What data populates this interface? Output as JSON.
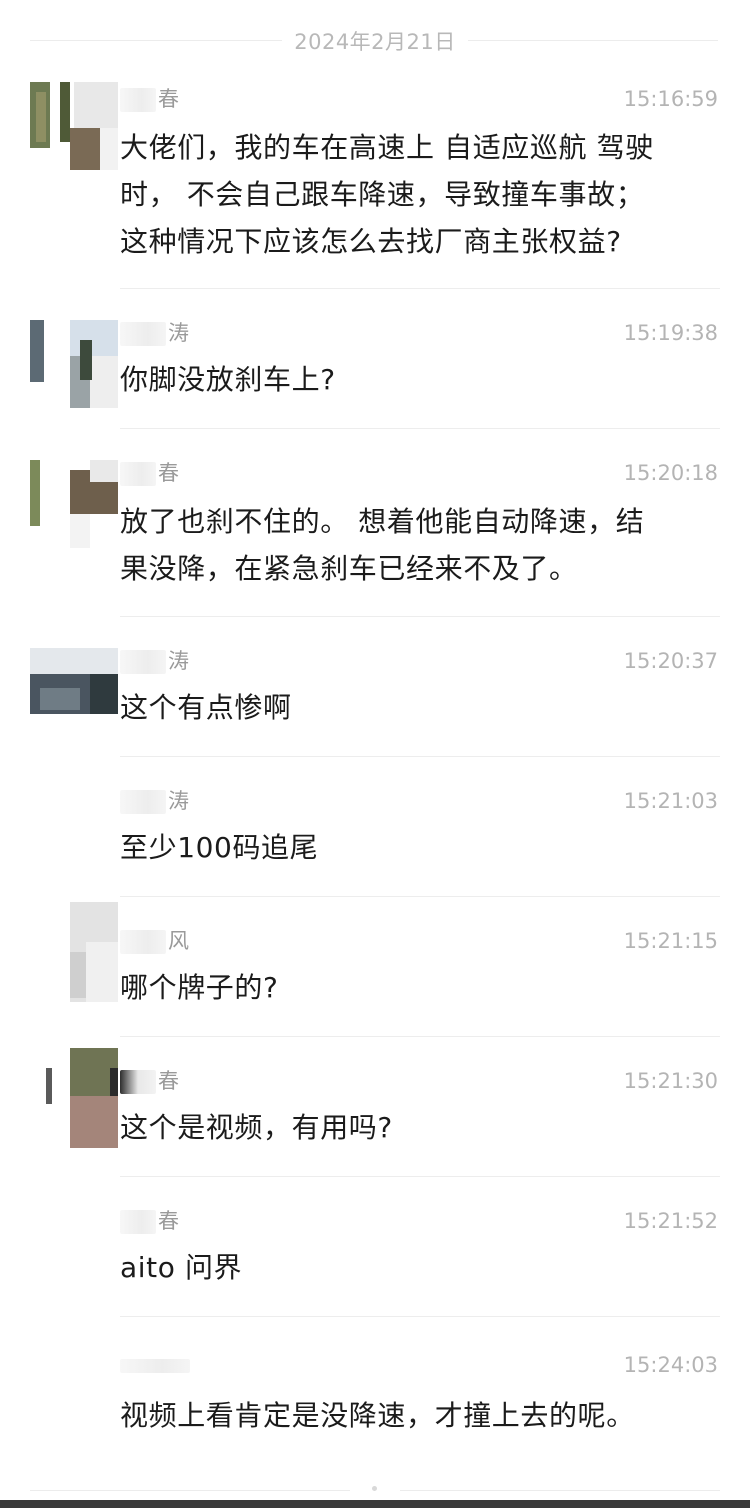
{
  "chat": {
    "date_separator": "2024年2月21日",
    "messages": [
      {
        "sender": "春",
        "time": "15:16:59",
        "lines": [
          "大佬们，我的车在高速上 自适应巡航 驾驶",
          "时， 不会自己跟车降速，导致撞车事故；",
          "这种情况下应该怎么去找厂商主张权益?"
        ]
      },
      {
        "sender": "涛",
        "time": "15:19:38",
        "lines": [
          "你脚没放刹车上?"
        ]
      },
      {
        "sender": "春",
        "time": "15:20:18",
        "lines": [
          "放了也刹不住的。 想着他能自动降速，结",
          "果没降，在紧急刹车已经来不及了。"
        ]
      },
      {
        "sender": "涛",
        "time": "15:20:37",
        "lines": [
          "这个有点惨啊"
        ]
      },
      {
        "sender": "涛",
        "time": "15:21:03",
        "lines": [
          "至少100码追尾"
        ]
      },
      {
        "sender": "风",
        "time": "15:21:15",
        "lines": [
          "哪个牌子的?"
        ]
      },
      {
        "sender": "春",
        "time": "15:21:30",
        "lines": [
          "这个是视频，有用吗?"
        ]
      },
      {
        "sender": "春",
        "time": "15:21:52",
        "lines": [
          "aito 问界"
        ]
      },
      {
        "sender": "",
        "time": "15:24:03",
        "lines": [
          "视频上看肯定是没降速，才撞上去的呢。"
        ]
      }
    ]
  },
  "colors": {
    "text": "#1b1b1b",
    "meta": "#b4b4b4",
    "name": "#9a9a9a",
    "divider": "#ededed",
    "background": "#ffffff"
  }
}
